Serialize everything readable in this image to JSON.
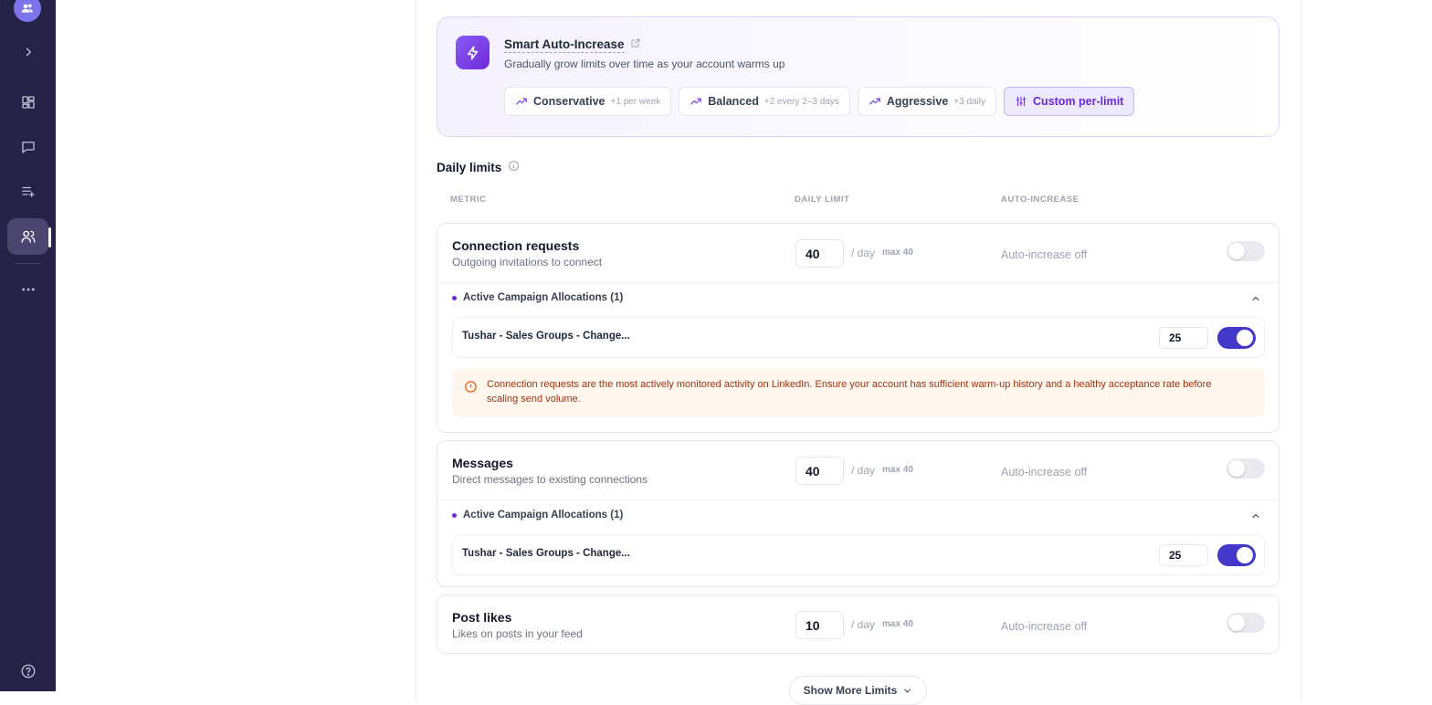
{
  "sidebar": {
    "items": [
      {
        "name": "expand",
        "icon": "chevron-right-icon"
      },
      {
        "name": "dashboard",
        "icon": "grid-icon"
      },
      {
        "name": "messages",
        "icon": "chat-icon"
      },
      {
        "name": "lists",
        "icon": "list-add-icon"
      },
      {
        "name": "accounts",
        "icon": "users-icon",
        "active": true
      },
      {
        "name": "more",
        "icon": "more-horizontal-icon"
      },
      {
        "name": "help",
        "icon": "help-circle-icon"
      }
    ]
  },
  "smart": {
    "title": "Smart Auto-Increase",
    "subtitle": "Gradually grow limits over time as your account warms up",
    "presets": [
      {
        "label": "Conservative",
        "note": "+1 per week"
      },
      {
        "label": "Balanced",
        "note": "+2 every 2–3 days"
      },
      {
        "label": "Aggressive",
        "note": "+3 daily"
      },
      {
        "label": "Custom per-limit",
        "note": ""
      }
    ]
  },
  "daily_limits": {
    "title": "Daily limits",
    "headers": {
      "metric": "METRIC",
      "limit": "DAILY LIMIT",
      "auto": "AUTO-INCREASE"
    }
  },
  "common": {
    "per_day": "/ day",
    "auto_off": "Auto-increase off",
    "alloc_header": "Active Campaign Allocations (1)",
    "show_more": "Show More Limits"
  },
  "metrics": [
    {
      "name": "Connection requests",
      "desc": "Outgoing invitations to connect",
      "value": "40",
      "max": "max 40",
      "allocation": {
        "name": "Tushar - Sales Groups - Change...",
        "value": "25"
      },
      "warning": "Connection requests are the most actively monitored activity on LinkedIn. Ensure your account has sufficient warm-up history and a healthy acceptance rate before scaling send volume."
    },
    {
      "name": "Messages",
      "desc": "Direct messages to existing connections",
      "value": "40",
      "max": "max 40",
      "allocation": {
        "name": "Tushar - Sales Groups - Change...",
        "value": "25"
      }
    },
    {
      "name": "Post likes",
      "desc": "Likes on posts in your feed",
      "value": "10",
      "max": "max 40"
    }
  ],
  "colors": {
    "sidebar": "#262247",
    "accent": "#6d28d9",
    "toggle_on": "#4338ca",
    "warning_bg": "#fff7ed"
  }
}
